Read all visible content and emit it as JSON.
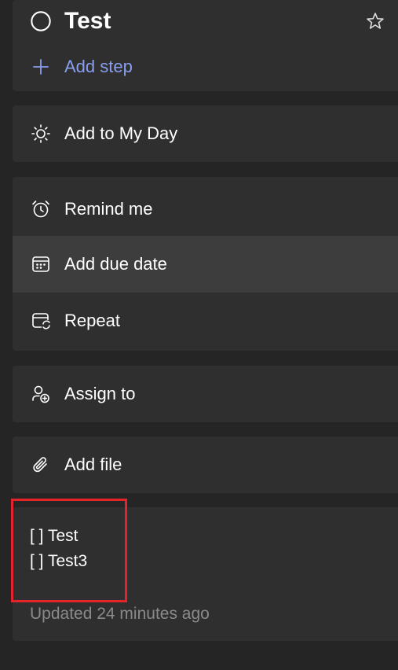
{
  "task": {
    "title": "Test",
    "add_step_label": "Add step"
  },
  "my_day": {
    "label": "Add to My Day"
  },
  "schedule": {
    "remind_label": "Remind me",
    "due_label": "Add due date",
    "repeat_label": "Repeat"
  },
  "assign": {
    "label": "Assign to"
  },
  "file": {
    "label": "Add file"
  },
  "note": {
    "lines": [
      "[ ] Test",
      "[ ] Test3"
    ]
  },
  "footer": {
    "updated_text": "Updated 24 minutes ago"
  },
  "colors": {
    "accent": "#8a9ef0",
    "highlight": "#e3242b",
    "card": "#2f2f2f",
    "background": "#252525"
  }
}
